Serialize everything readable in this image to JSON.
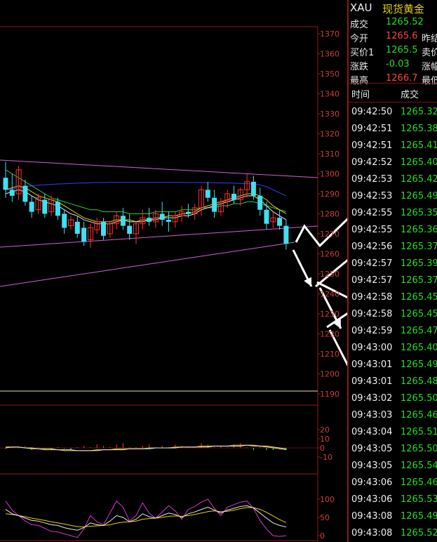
{
  "header": {
    "symbol": "XAU",
    "name": "现货黄金"
  },
  "quote": [
    {
      "label": "成交",
      "value": "1265.52",
      "color": "#1fe01f",
      "label2": ""
    },
    {
      "label": "今开",
      "value": "1265.6",
      "color": "#ff4040",
      "label2": "昨结"
    },
    {
      "label": "买价1",
      "value": "1265.5",
      "color": "#1fe01f",
      "label2": "卖价"
    },
    {
      "label": "涨跌",
      "value": "-0.03",
      "color": "#1fe01f",
      "label2": "涨幅"
    },
    {
      "label": "最高",
      "value": "1266.7",
      "color": "#ff4040",
      "label2": "最低"
    }
  ],
  "ticks_header": {
    "time": "时间",
    "price": "成交"
  },
  "ticks": [
    {
      "time": "09:42:50",
      "price": "1265.32"
    },
    {
      "time": "09:42:51",
      "price": "1265.38"
    },
    {
      "time": "09:42:51",
      "price": "1265.41"
    },
    {
      "time": "09:42:52",
      "price": "1265.40"
    },
    {
      "time": "09:42:53",
      "price": "1265.42"
    },
    {
      "time": "09:42:53",
      "price": "1265.49"
    },
    {
      "time": "09:42:55",
      "price": "1265.35"
    },
    {
      "time": "09:42:55",
      "price": "1265.36"
    },
    {
      "time": "09:42:56",
      "price": "1265.37"
    },
    {
      "time": "09:42:57",
      "price": "1265.39"
    },
    {
      "time": "09:42:57",
      "price": "1265.37"
    },
    {
      "time": "09:42:58",
      "price": "1265.45"
    },
    {
      "time": "09:42:58",
      "price": "1265.45"
    },
    {
      "time": "09:42:59",
      "price": "1265.47"
    },
    {
      "time": "09:43:00",
      "price": "1265.40"
    },
    {
      "time": "09:43:01",
      "price": "1265.49"
    },
    {
      "time": "09:43:01",
      "price": "1265.48"
    },
    {
      "time": "09:43:02",
      "price": "1265.50"
    },
    {
      "time": "09:43:03",
      "price": "1265.46"
    },
    {
      "time": "09:43:04",
      "price": "1265.51"
    },
    {
      "time": "09:43:05",
      "price": "1265.50"
    },
    {
      "time": "09:43:05",
      "price": "1265.54"
    },
    {
      "time": "09:43:06",
      "price": "1265.46"
    },
    {
      "time": "09:43:06",
      "price": "1265.53"
    },
    {
      "time": "09:43:08",
      "price": "1265.49"
    },
    {
      "time": "09:43:08",
      "price": "1265.52"
    }
  ],
  "price_axis": {
    "ticks": [
      "1370",
      "1360",
      "1350",
      "1340",
      "1330",
      "1320",
      "1310",
      "1300",
      "1290",
      "1280",
      "1270",
      "1260",
      "1250",
      "1240",
      "1230",
      "1220",
      "1210",
      "1200",
      "1190"
    ]
  },
  "ind1_axis": {
    "ticks": [
      "20",
      "10",
      "0",
      "-10"
    ]
  },
  "ind2_axis": {
    "ticks": [
      "100",
      "50",
      "0"
    ]
  },
  "chart_data": {
    "type": "candlestick",
    "ylim": [
      1190,
      1375
    ],
    "candles": [
      {
        "o": 1298,
        "h": 1306,
        "l": 1288,
        "c": 1292
      },
      {
        "o": 1292,
        "h": 1300,
        "l": 1286,
        "c": 1289
      },
      {
        "o": 1290,
        "h": 1304,
        "l": 1287,
        "c": 1302
      },
      {
        "o": 1294,
        "h": 1297,
        "l": 1284,
        "c": 1286
      },
      {
        "o": 1286,
        "h": 1289,
        "l": 1278,
        "c": 1281
      },
      {
        "o": 1282,
        "h": 1290,
        "l": 1280,
        "c": 1288
      },
      {
        "o": 1287,
        "h": 1290,
        "l": 1278,
        "c": 1280
      },
      {
        "o": 1281,
        "h": 1289,
        "l": 1279,
        "c": 1287
      },
      {
        "o": 1286,
        "h": 1288,
        "l": 1277,
        "c": 1279
      },
      {
        "o": 1280,
        "h": 1282,
        "l": 1270,
        "c": 1273
      },
      {
        "o": 1274,
        "h": 1279,
        "l": 1272,
        "c": 1277
      },
      {
        "o": 1276,
        "h": 1279,
        "l": 1268,
        "c": 1270
      },
      {
        "o": 1273,
        "h": 1276,
        "l": 1264,
        "c": 1266
      },
      {
        "o": 1267,
        "h": 1275,
        "l": 1263,
        "c": 1273
      },
      {
        "o": 1272,
        "h": 1278,
        "l": 1270,
        "c": 1276
      },
      {
        "o": 1276,
        "h": 1278,
        "l": 1267,
        "c": 1269
      },
      {
        "o": 1270,
        "h": 1276,
        "l": 1268,
        "c": 1275
      },
      {
        "o": 1275,
        "h": 1281,
        "l": 1272,
        "c": 1279
      },
      {
        "o": 1279,
        "h": 1283,
        "l": 1272,
        "c": 1274
      },
      {
        "o": 1274,
        "h": 1280,
        "l": 1267,
        "c": 1270
      },
      {
        "o": 1270,
        "h": 1276,
        "l": 1265,
        "c": 1275
      },
      {
        "o": 1275,
        "h": 1282,
        "l": 1272,
        "c": 1278
      },
      {
        "o": 1278,
        "h": 1283,
        "l": 1274,
        "c": 1276
      },
      {
        "o": 1276,
        "h": 1282,
        "l": 1273,
        "c": 1280
      },
      {
        "o": 1280,
        "h": 1286,
        "l": 1274,
        "c": 1277
      },
      {
        "o": 1277,
        "h": 1281,
        "l": 1271,
        "c": 1276
      },
      {
        "o": 1276,
        "h": 1281,
        "l": 1273,
        "c": 1279
      },
      {
        "o": 1279,
        "h": 1284,
        "l": 1276,
        "c": 1281
      },
      {
        "o": 1281,
        "h": 1285,
        "l": 1278,
        "c": 1280
      },
      {
        "o": 1280,
        "h": 1285,
        "l": 1277,
        "c": 1283
      },
      {
        "o": 1283,
        "h": 1294,
        "l": 1279,
        "c": 1292
      },
      {
        "o": 1292,
        "h": 1296,
        "l": 1286,
        "c": 1288
      },
      {
        "o": 1288,
        "h": 1292,
        "l": 1278,
        "c": 1281
      },
      {
        "o": 1281,
        "h": 1288,
        "l": 1279,
        "c": 1286
      },
      {
        "o": 1286,
        "h": 1292,
        "l": 1283,
        "c": 1290
      },
      {
        "o": 1290,
        "h": 1294,
        "l": 1285,
        "c": 1287
      },
      {
        "o": 1287,
        "h": 1293,
        "l": 1284,
        "c": 1292
      },
      {
        "o": 1292,
        "h": 1300,
        "l": 1288,
        "c": 1296
      },
      {
        "o": 1296,
        "h": 1299,
        "l": 1287,
        "c": 1289
      },
      {
        "o": 1289,
        "h": 1293,
        "l": 1279,
        "c": 1282
      },
      {
        "o": 1282,
        "h": 1286,
        "l": 1272,
        "c": 1275
      },
      {
        "o": 1276,
        "h": 1281,
        "l": 1273,
        "c": 1278
      },
      {
        "o": 1278,
        "h": 1282,
        "l": 1272,
        "c": 1274
      },
      {
        "o": 1274,
        "h": 1277,
        "l": 1262,
        "c": 1265
      }
    ],
    "ma_white": [
      1290,
      1291,
      1292,
      1291,
      1289,
      1287,
      1286,
      1285,
      1284,
      1282,
      1280,
      1279,
      1277,
      1276,
      1275,
      1275,
      1275,
      1276,
      1277,
      1276,
      1276,
      1276,
      1277,
      1277,
      1278,
      1278,
      1278,
      1279,
      1279,
      1280,
      1282,
      1283,
      1284,
      1285,
      1286,
      1287,
      1288,
      1289,
      1289,
      1287,
      1284,
      1281,
      1279,
      1277
    ],
    "ma_yellow": [
      1292,
      1293,
      1294,
      1293,
      1291,
      1289,
      1288,
      1287,
      1286,
      1284,
      1282,
      1280,
      1278,
      1277,
      1276,
      1276,
      1276,
      1277,
      1277,
      1277,
      1276,
      1277,
      1277,
      1278,
      1278,
      1279,
      1279,
      1280,
      1280,
      1281,
      1283,
      1284,
      1285,
      1286,
      1287,
      1288,
      1289,
      1290,
      1290,
      1289,
      1287,
      1284,
      1282,
      1280
    ],
    "ma_green": [
      1302,
      1300,
      1298,
      1296,
      1294,
      1292,
      1290,
      1288,
      1287,
      1286,
      1285,
      1284,
      1283,
      1282,
      1282,
      1281,
      1281,
      1281,
      1281,
      1280,
      1280,
      1280,
      1280,
      1281,
      1281,
      1281,
      1281,
      1282,
      1282,
      1282,
      1283,
      1283,
      1283,
      1284,
      1284,
      1285,
      1285,
      1286,
      1286,
      1285,
      1284,
      1283,
      1282,
      1281
    ],
    "ma_blue": [
      1292,
      1292.5,
      1293,
      1293.5,
      1294,
      1294.3,
      1294.5,
      1294.7,
      1294.9,
      1295,
      1295.2,
      1295.3,
      1295.4,
      1295.5,
      1295.6,
      1295.6,
      1295.7,
      1295.7,
      1295.7,
      1295.7,
      1295.7,
      1295.7,
      1295.7,
      1295.7,
      1295.7,
      1295.7,
      1295.7,
      1295.7,
      1295.6,
      1295.6,
      1295.6,
      1295.5,
      1295.5,
      1295.4,
      1295.4,
      1295.3,
      1295.2,
      1295.1,
      1294.9,
      1294.5,
      1293.5,
      1292,
      1290.5,
      1289
    ],
    "macd": [
      0,
      1,
      1,
      0,
      -1,
      -1,
      -2,
      -2,
      -2,
      -3,
      -3,
      -3,
      -3,
      -3,
      -2,
      -2,
      -2,
      -1,
      -1,
      -1,
      -1,
      -1,
      0,
      0,
      0,
      0,
      1,
      1,
      1,
      1,
      2,
      2,
      2,
      2,
      2,
      3,
      3,
      3,
      2,
      2,
      1,
      0,
      -1,
      -2
    ],
    "macd_signal": [
      1,
      1,
      1,
      0,
      0,
      -1,
      -1,
      -1,
      -2,
      -2,
      -2,
      -3,
      -3,
      -3,
      -3,
      -2,
      -2,
      -2,
      -2,
      -1,
      -1,
      -1,
      -1,
      0,
      0,
      0,
      0,
      1,
      1,
      1,
      1,
      1,
      2,
      2,
      2,
      2,
      2,
      3,
      3,
      2,
      2,
      1,
      0,
      -1
    ],
    "kdj_k": [
      72,
      60,
      55,
      48,
      42,
      40,
      35,
      30,
      28,
      22,
      18,
      15,
      22,
      35,
      30,
      28,
      40,
      55,
      50,
      38,
      45,
      60,
      52,
      48,
      55,
      62,
      58,
      50,
      60,
      65,
      72,
      78,
      70,
      62,
      70,
      75,
      80,
      82,
      76,
      62,
      48,
      35,
      28,
      24
    ],
    "kdj_d": [
      60,
      58,
      55,
      52,
      48,
      45,
      42,
      38,
      35,
      32,
      28,
      25,
      24,
      26,
      27,
      28,
      30,
      34,
      37,
      38,
      40,
      45,
      47,
      48,
      50,
      53,
      54,
      53,
      55,
      58,
      62,
      66,
      68,
      66,
      67,
      70,
      74,
      77,
      77,
      72,
      64,
      54,
      44,
      36
    ],
    "kdj_j": [
      95,
      70,
      55,
      40,
      30,
      28,
      20,
      12,
      10,
      5,
      0,
      -5,
      18,
      55,
      38,
      30,
      62,
      95,
      78,
      40,
      55,
      90,
      62,
      48,
      65,
      82,
      68,
      45,
      72,
      80,
      92,
      100,
      75,
      55,
      78,
      85,
      92,
      95,
      75,
      42,
      18,
      0,
      -2,
      0
    ]
  }
}
